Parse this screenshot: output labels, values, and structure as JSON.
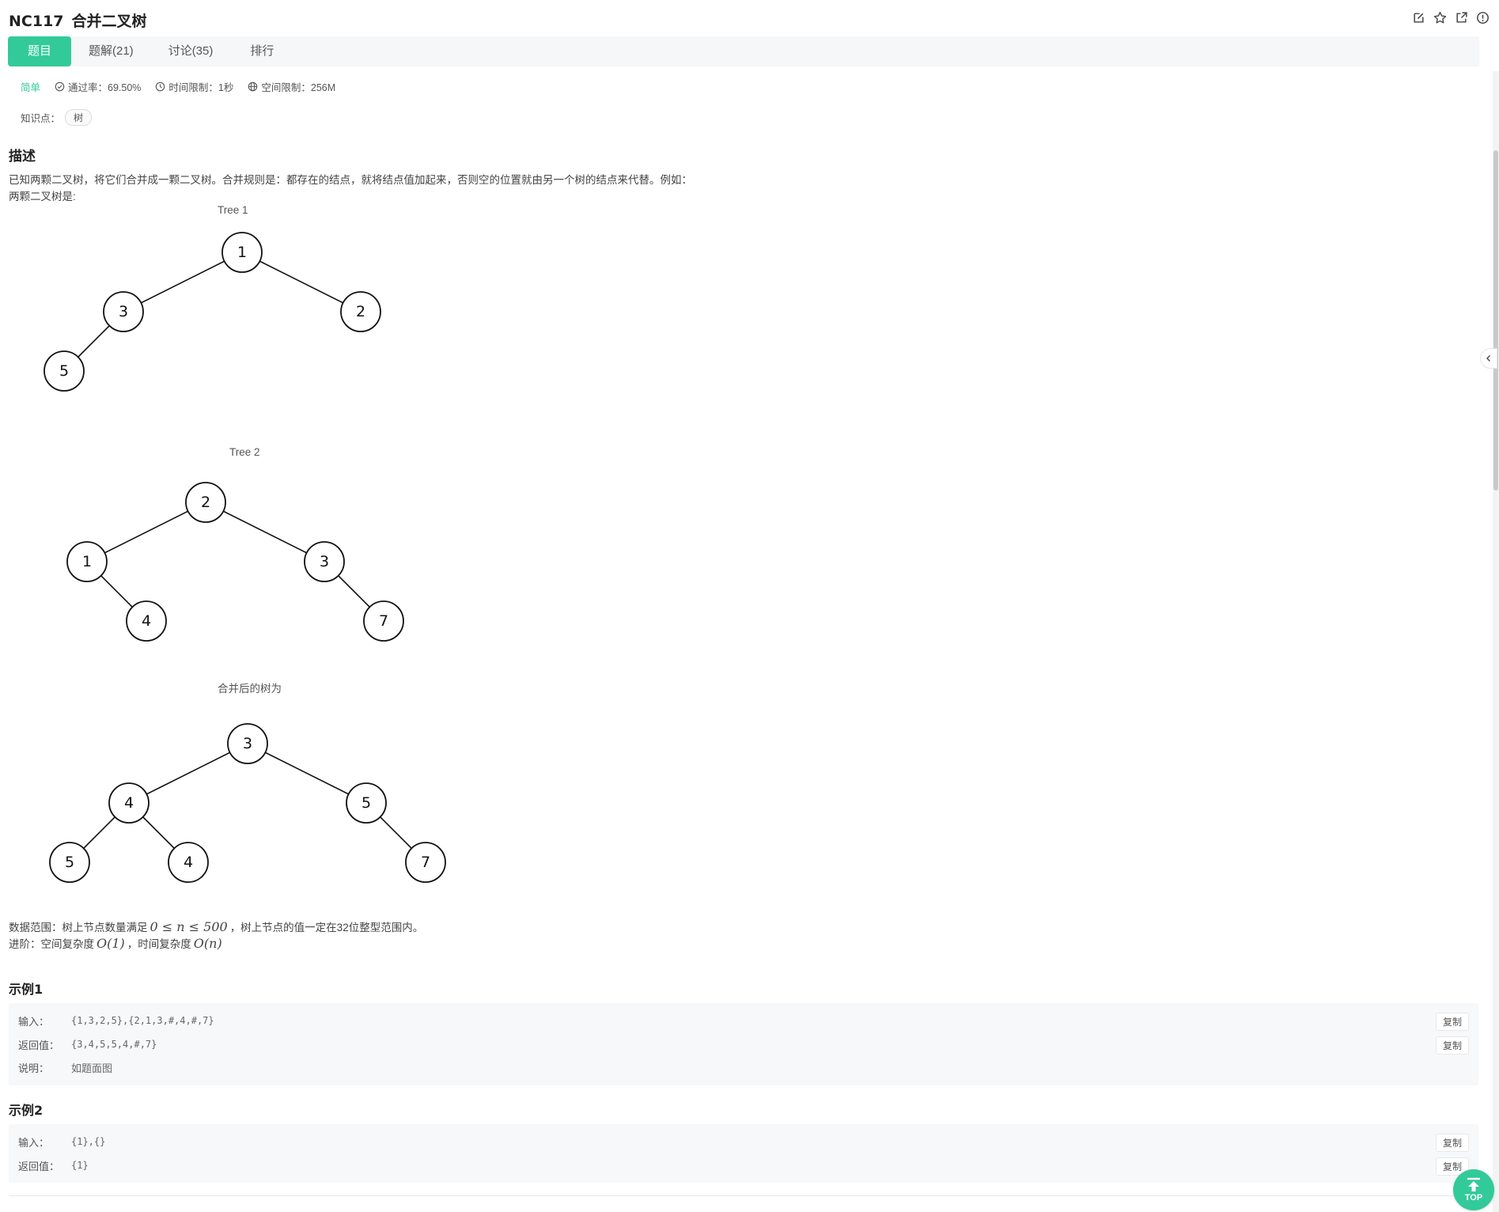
{
  "problem": {
    "code": "NC117",
    "title": "合并二叉树"
  },
  "tabs": [
    {
      "label": "题目",
      "active": true
    },
    {
      "label": "题解(21)"
    },
    {
      "label": "讨论(35)"
    },
    {
      "label": "排行"
    }
  ],
  "meta": {
    "difficulty": "简单",
    "pass_rate": "通过率：69.50%",
    "time_limit": "时间限制：1秒",
    "space_limit": "空间限制：256M"
  },
  "knowledge": {
    "label": "知识点：",
    "tags": [
      "树"
    ]
  },
  "description": {
    "title": "描述",
    "line1": "已知两颗二叉树，将它们合并成一颗二叉树。合并规则是：都存在的结点，就将结点值加起来，否则空的位置就由另一个树的结点来代替。例如：",
    "line2": "两颗二叉树是:"
  },
  "trees": [
    {
      "caption": "Tree 1",
      "values": [
        "1",
        "3",
        "2",
        "5"
      ]
    },
    {
      "caption": "Tree 2",
      "values": [
        "2",
        "1",
        "3",
        "4",
        "7"
      ]
    },
    {
      "caption": "合并后的树为",
      "values": [
        "3",
        "4",
        "5",
        "5",
        "4",
        "7"
      ]
    }
  ],
  "constraints": {
    "range_prefix": "数据范围：树上节点数量满足",
    "range_math": "0 ≤ n ≤ 500",
    "range_suffix": "，树上节点的值一定在32位整型范围内。",
    "adv_prefix": "进阶：空间复杂度",
    "adv_math1": "O(1)",
    "adv_mid": "，时间复杂度",
    "adv_math2": "O(n)"
  },
  "examples": [
    {
      "title": "示例1",
      "input_label": "输入：",
      "input": "{1,3,2,5},{2,1,3,#,4,#,7}",
      "output_label": "返回值：",
      "output": "{3,4,5,5,4,#,7}",
      "note_label": "说明：",
      "note": "如题面图",
      "copy_label": "复制"
    },
    {
      "title": "示例2",
      "input_label": "输入：",
      "input": "{1},{}",
      "output_label": "返回值：",
      "output": "{1}",
      "copy_label": "复制"
    }
  ],
  "top_button": {
    "label": "TOP"
  }
}
